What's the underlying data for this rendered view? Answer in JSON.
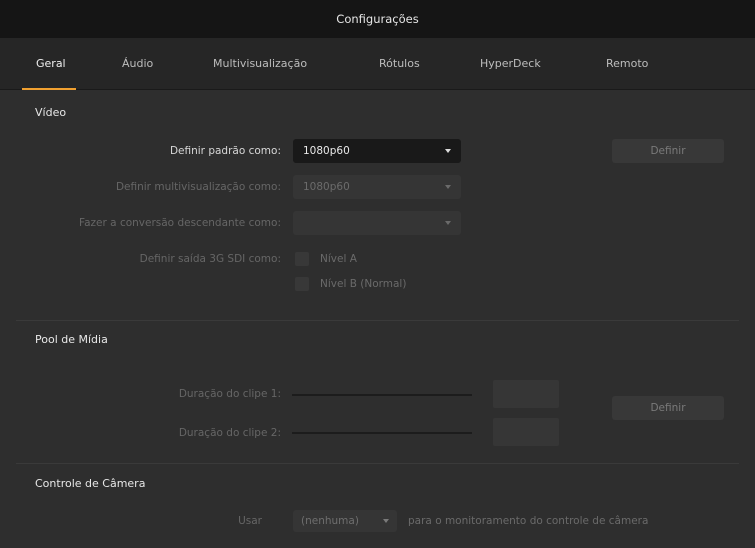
{
  "window": {
    "title": "Configurações"
  },
  "tabs": [
    {
      "label": "Geral",
      "active": true
    },
    {
      "label": "Áudio",
      "active": false
    },
    {
      "label": "Multivisualização",
      "active": false
    },
    {
      "label": "Rótulos",
      "active": false
    },
    {
      "label": "HyperDeck",
      "active": false
    },
    {
      "label": "Remoto",
      "active": false
    }
  ],
  "video": {
    "title": "Vídeo",
    "standard_label": "Definir padrão como:",
    "standard_value": "1080p60",
    "set_button": "Definir",
    "multiview_label": "Definir multivisualização como:",
    "multiview_value": "1080p60",
    "downconvert_label": "Fazer a conversão descendante como:",
    "downconvert_value": "",
    "sdi_label": "Definir saída 3G SDI como:",
    "level_a": "Nível A",
    "level_b": "Nível B (Normal)"
  },
  "media_pool": {
    "title": "Pool de Mídia",
    "clip1_label": "Duração do clipe 1:",
    "clip2_label": "Duração do clipe 2:",
    "set_button": "Definir"
  },
  "camera_control": {
    "title": "Controle de Câmera",
    "use_label": "Usar",
    "use_value": "(nenhuma)",
    "suffix": "para o monitoramento do controle de câmera"
  },
  "colors": {
    "accent": "#f0a030",
    "background": "#2e2e2e",
    "titlebar": "#151515"
  }
}
